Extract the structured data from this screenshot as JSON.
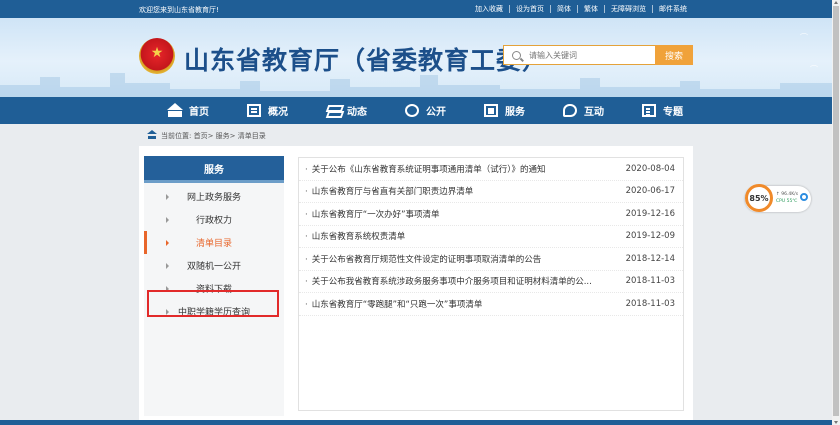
{
  "topbar": {
    "welcome": "欢迎您来到山东省教育厅!",
    "links": [
      "加入收藏",
      "设为首页",
      "简体",
      "繁体",
      "无障碍浏览",
      "邮件系统"
    ]
  },
  "header": {
    "title": "山东省教育厅（省委教育工委）",
    "search_placeholder": "请输入关键词",
    "search_button": "搜索"
  },
  "nav": {
    "items": [
      {
        "label": "首页",
        "icon": "home-icon"
      },
      {
        "label": "概况",
        "icon": "overview-icon"
      },
      {
        "label": "动态",
        "icon": "layers-icon"
      },
      {
        "label": "公开",
        "icon": "open-icon"
      },
      {
        "label": "服务",
        "icon": "service-icon"
      },
      {
        "label": "互动",
        "icon": "chat-icon"
      },
      {
        "label": "专题",
        "icon": "topic-icon"
      }
    ]
  },
  "breadcrumb": {
    "text": "当前位置: 首页> 服务> 清单目录"
  },
  "sidebar": {
    "title": "服务",
    "items": [
      {
        "label": "网上政务服务"
      },
      {
        "label": "行政权力"
      },
      {
        "label": "清单目录"
      },
      {
        "label": "双随机一公开"
      },
      {
        "label": "资料下载"
      },
      {
        "label": "中职学籍学历查询"
      }
    ],
    "active_index": 2
  },
  "list": [
    {
      "title": "关于公布《山东省教育系统证明事项通用清单（试行）》的通知",
      "date": "2020-08-04"
    },
    {
      "title": "山东省教育厅与省直有关部门职责边界清单",
      "date": "2020-06-17"
    },
    {
      "title": "山东省教育厅“一次办好”事项清单",
      "date": "2019-12-16"
    },
    {
      "title": "山东省教育系统权责清单",
      "date": "2019-12-09"
    },
    {
      "title": "关于公布省教育厅规范性文件设定的证明事项取消清单的公告",
      "date": "2018-12-14"
    },
    {
      "title": "关于公布我省教育系统涉政务服务事项中介服务项目和证明材料清单的公...",
      "date": "2018-11-03"
    },
    {
      "title": "山东省教育厅“零跑腿”和“只跑一次”事项清单",
      "date": "2018-11-03"
    }
  ],
  "widget": {
    "percent": "85%",
    "net": "↑ 96.4K/s",
    "cpu": "CPU 55℃"
  },
  "colors": {
    "primary": "#1f5e96",
    "accent": "#f0a23a",
    "active": "#e8662b",
    "highlight": "#e22a2a"
  }
}
